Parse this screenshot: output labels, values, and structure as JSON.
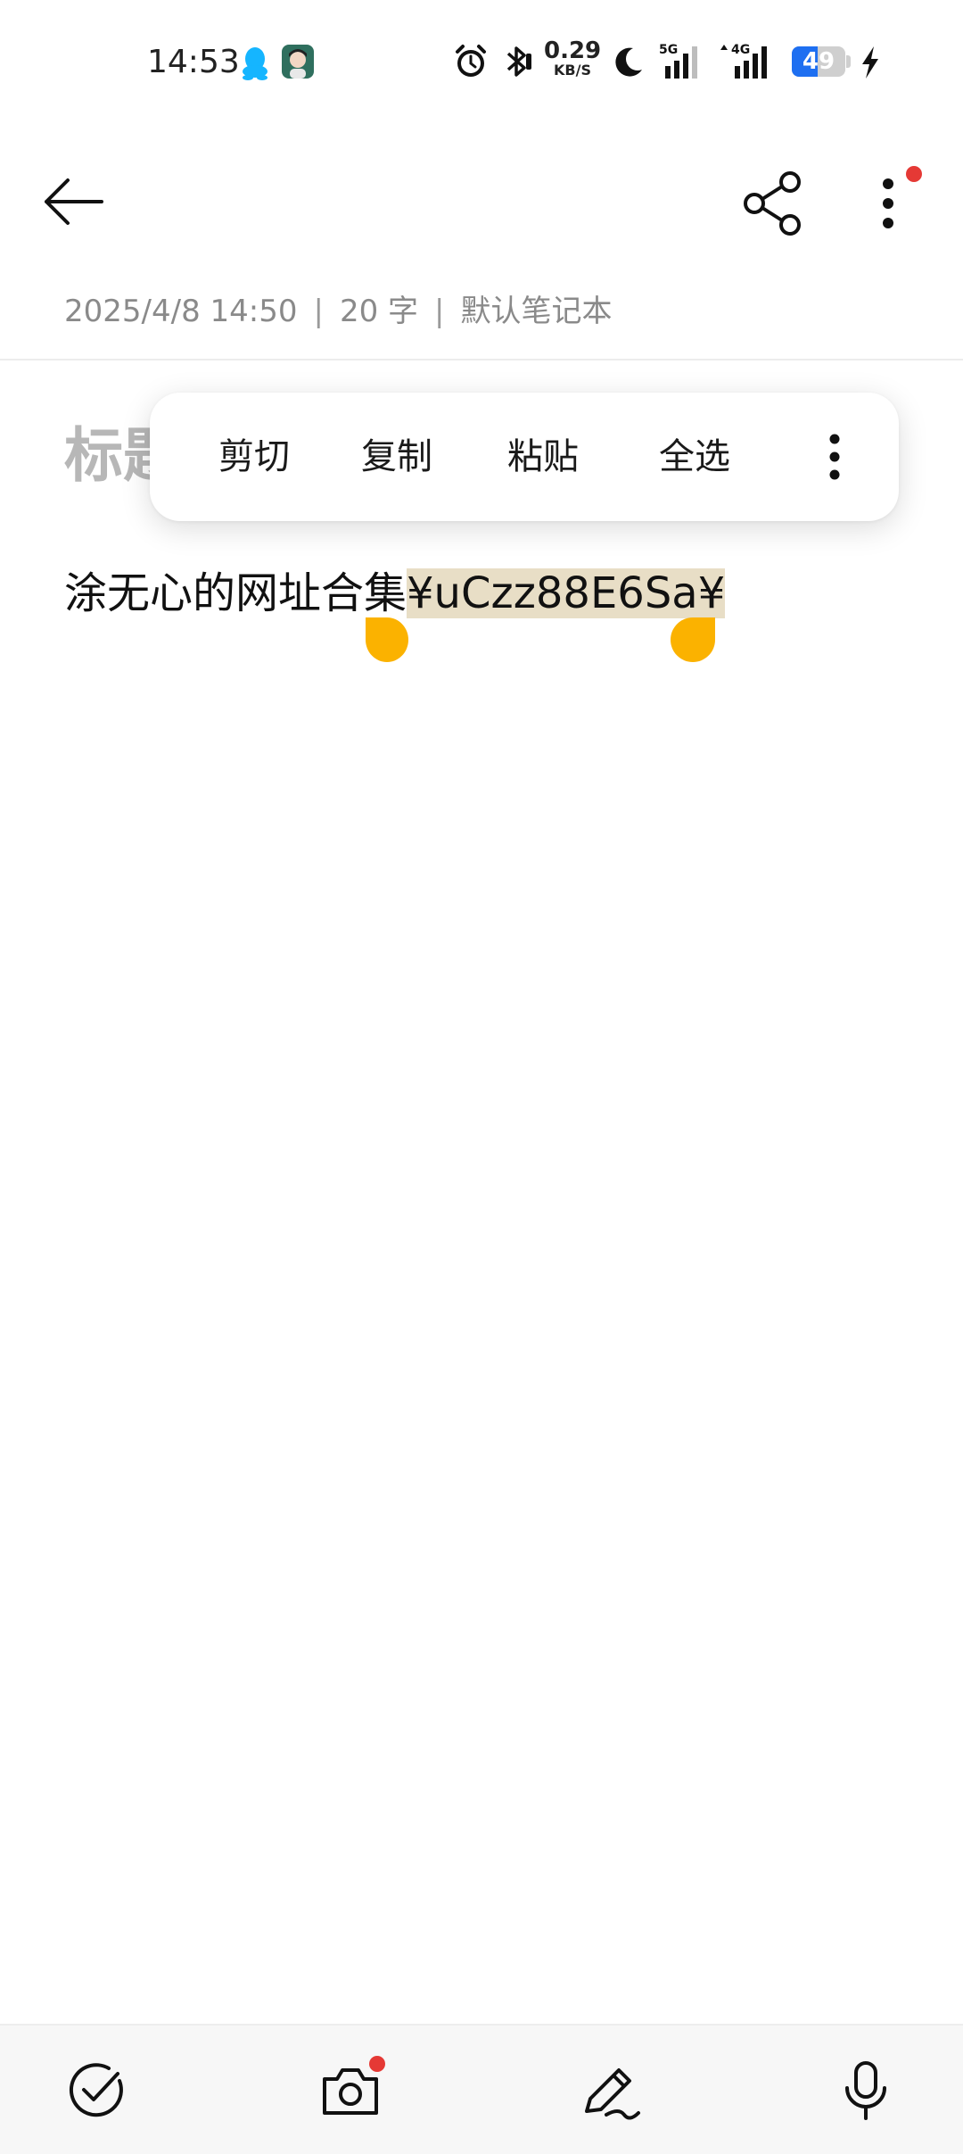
{
  "status_bar": {
    "time": "14:53",
    "net_speed_value": "0.29",
    "net_speed_unit": "KB/S",
    "signal_5g": "5G",
    "signal_4g": "4G",
    "battery_level": "49",
    "icons": [
      "qq-icon",
      "app-avatar-icon",
      "alarm-icon",
      "bluetooth-icon",
      "moon-icon",
      "signal-icon",
      "battery-icon",
      "charging-icon"
    ]
  },
  "toolbar": {
    "icons": [
      "back-arrow-icon",
      "share-icon",
      "more-vertical-icon"
    ]
  },
  "note": {
    "date": "2025/4/8 14:50",
    "separator": "|",
    "word_count": "20 字",
    "notebook": "默认笔记本",
    "title_placeholder": "标题",
    "body_prefix": "涂无心的网址合集",
    "body_selected": "¥uCzz88E6Sa¥"
  },
  "context_menu": {
    "items": [
      "剪切",
      "复制",
      "粘贴",
      "全选"
    ]
  },
  "bottom_bar": {
    "icons": [
      "checklist-icon",
      "camera-icon",
      "pen-icon",
      "microphone-icon"
    ]
  },
  "colors": {
    "accent": "#fbb200",
    "selection": "#e8dec6",
    "badge": "#e53935",
    "battery": "#1e6ff1"
  }
}
